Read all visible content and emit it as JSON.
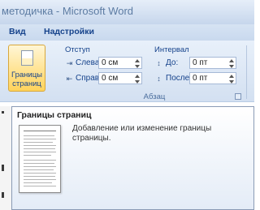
{
  "window": {
    "title": "методичка - Microsoft Word"
  },
  "ribbon_tabs": [
    "Вид",
    "Надстройки"
  ],
  "ribbon": {
    "page_borders_button": {
      "label_line1": "Границы",
      "label_line2": "страниц"
    },
    "indent": {
      "title": "Отступ",
      "left": {
        "label": "Слева:",
        "value": "0 см"
      },
      "right": {
        "label": "Справа:",
        "value": "0 см"
      }
    },
    "spacing": {
      "title": "Интервал",
      "before": {
        "label": "До:",
        "value": "0 пт"
      },
      "after": {
        "label": "После:",
        "value": "0 пт"
      }
    },
    "group_name": "Абзац"
  },
  "tooltip": {
    "title": "Границы страниц",
    "description": "Добавление или изменение границы страницы."
  },
  "icons": {
    "page_borders": "page-borders-icon",
    "indent_left": "indent-left-icon",
    "indent_right": "indent-right-icon",
    "spacing_before": "spacing-before-icon",
    "spacing_after": "spacing-after-icon",
    "dialog_launcher": "dialog-launcher-icon"
  },
  "colors": {
    "ribbon_text": "#15428b",
    "button_highlight": "#ffd35a",
    "ribbon_background": "#dde8f5"
  }
}
